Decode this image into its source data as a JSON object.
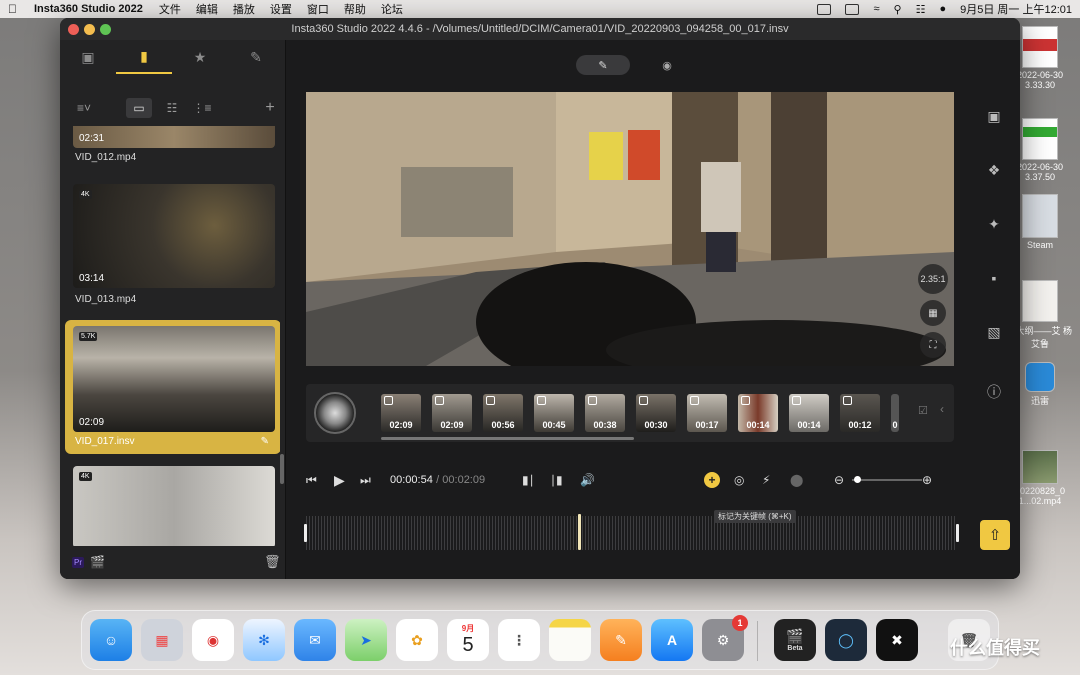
{
  "menubar": {
    "app_name": "Insta360 Studio 2022",
    "menus": [
      "文件",
      "编辑",
      "播放",
      "设置",
      "窗口",
      "帮助",
      "论坛"
    ],
    "clock": "9月5日 周一 上午12:01"
  },
  "desktop": {
    "items": [
      {
        "label": "2022-06-30 3.33.30"
      },
      {
        "label": "2022-06-30 3.37.50"
      },
      {
        "label": "Steam"
      },
      {
        "label": "2.大纲——艾 杨艾鲁"
      },
      {
        "label": "迅雷"
      },
      {
        "label": "20220828_0 1...02.mp4"
      }
    ]
  },
  "window": {
    "title": "Insta360 Studio 2022 4.4.6 - /Volumes/Untitled/DCIM/Camera01/VID_20220903_094258_00_017.insv"
  },
  "media": {
    "items": [
      {
        "name": "VID_012.mp4",
        "duration": "02:31",
        "badge": "",
        "selected": false
      },
      {
        "name": "VID_013.mp4",
        "duration": "03:14",
        "badge": "4K",
        "selected": false
      },
      {
        "name": "VID_017.insv",
        "duration": "02:09",
        "badge": "5.7K",
        "selected": true
      },
      {
        "name": "",
        "duration": "",
        "badge": "4K",
        "selected": false
      }
    ],
    "footer_badge": "Pr"
  },
  "preview": {
    "aspect_ratio": "2.35:1"
  },
  "clips": {
    "times": [
      "02:09",
      "02:09",
      "00:56",
      "00:45",
      "00:38",
      "00:30",
      "00:17",
      "00:14",
      "00:14",
      "00:12",
      "0"
    ]
  },
  "playback": {
    "current_time": "00:00:54",
    "total_time": "/ 00:02:09"
  },
  "timeline": {
    "tooltip": "标记为关键帧 (⌘+K)"
  },
  "dock": {
    "calendar_month": "9月",
    "calendar_day": "5",
    "settings_badge": "1",
    "beta_label": "Beta"
  },
  "watermark": "什么值得买",
  "colors": {
    "accent": "#f0c842",
    "window_bg": "#1c1c1d"
  }
}
